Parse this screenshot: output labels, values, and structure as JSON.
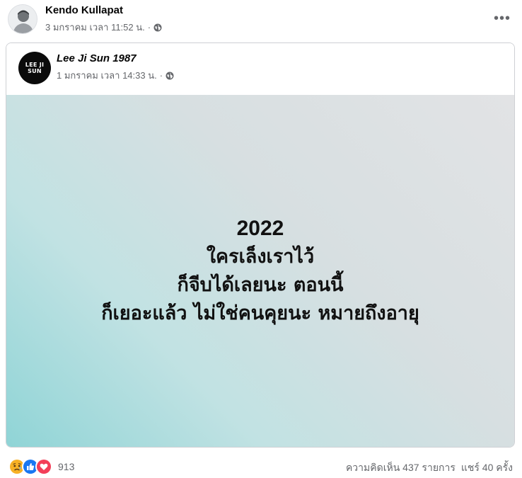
{
  "post": {
    "author": "Kendo Kullapat",
    "timestamp": "3 มกราคม เวลา 11:52 น.",
    "separator": "·",
    "more_icon": "more-horizontal-icon",
    "audience_icon": "globe-icon"
  },
  "shared_post": {
    "page_name": "Lee Ji Sun 1987",
    "logo_text": "LEE JI SUN",
    "timestamp": "1 มกราคม เวลา 14:33 น.",
    "separator": "·",
    "audience_icon": "globe-icon",
    "image_text": {
      "line1": "2022",
      "line2": "ใครเล็งเราไว้",
      "line3": "ก็จีบได้เลยนะ ตอนนี้",
      "line4": "ก็เยอะแล้ว ไม่ใช่คนคุยนะ หมายถึงอายุ"
    }
  },
  "footer": {
    "reaction_icons": [
      "sad-reaction-icon",
      "like-reaction-icon",
      "love-reaction-icon"
    ],
    "reaction_count": "913",
    "comments": "ความคิดเห็น 437 รายการ",
    "shares": "แชร์ 40 ครั้ง"
  },
  "colors": {
    "secondary_text": "#65676b",
    "like_blue": "#1877f2",
    "love_red": "#f33e58",
    "sad_yellow": "#f7b125"
  }
}
